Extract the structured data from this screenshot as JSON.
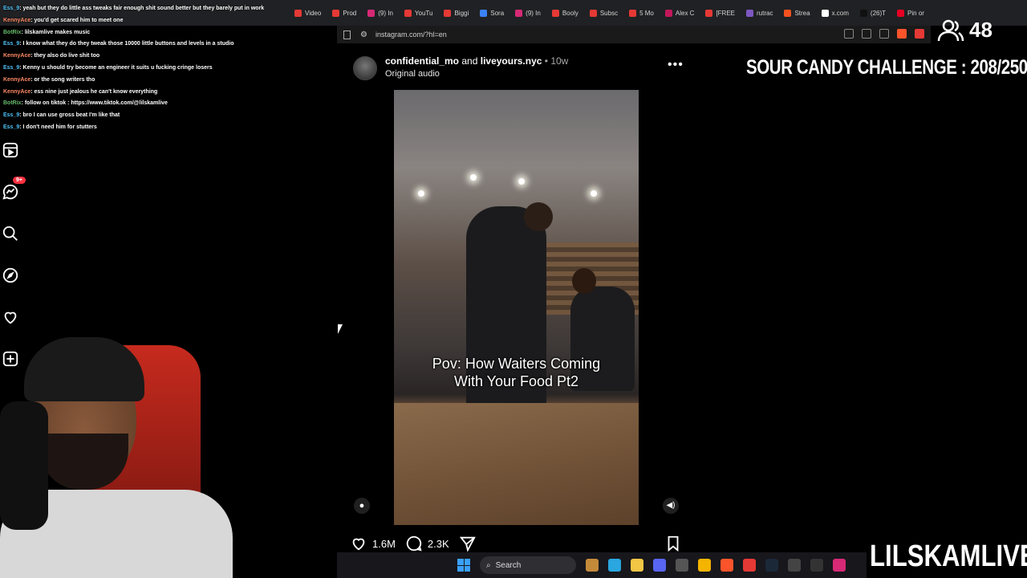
{
  "browser": {
    "tabs": [
      {
        "label": "Video",
        "color": "#e53935"
      },
      {
        "label": "Prod",
        "color": "#e53935"
      },
      {
        "label": "(9) In",
        "color": "#d62976"
      },
      {
        "label": "YouTu",
        "color": "#e53935"
      },
      {
        "label": "Biggi",
        "color": "#e53935"
      },
      {
        "label": "Sora",
        "color": "#3b82f6"
      },
      {
        "label": "(9) In",
        "color": "#d62976"
      },
      {
        "label": "Booly",
        "color": "#e53935"
      },
      {
        "label": "Subsc",
        "color": "#e53935"
      },
      {
        "label": "5 Mo",
        "color": "#e53935"
      },
      {
        "label": "Alex C",
        "color": "#c2185b"
      },
      {
        "label": "[FREE",
        "color": "#e53935"
      },
      {
        "label": "rutrac",
        "color": "#7e57c2"
      },
      {
        "label": "Strea",
        "color": "#f4511e"
      },
      {
        "label": "x.com",
        "color": "#ffffff"
      },
      {
        "label": "(26)T",
        "color": "#111111"
      },
      {
        "label": "Pin or",
        "color": "#e60023"
      }
    ],
    "url": "instagram.com/?hl=en"
  },
  "chat": [
    {
      "user": "Ess_9",
      "text": ": yeah but they do little ass tweaks fair enough shit sound better but they barely put in work",
      "color": "#4fc3f7"
    },
    {
      "user": "KennyAce",
      "text": ": you'd get scared him to meet one",
      "color": "#ff8a65"
    },
    {
      "user": "BotRix",
      "text": ": lilskamlive makes music",
      "color": "#66bb6a"
    },
    {
      "user": "Ess_9",
      "text": ": I know what they do they tweak those 10000 little buttons and levels in a studio",
      "color": "#4fc3f7"
    },
    {
      "user": "KennyAce",
      "text": ": they also do live shit too",
      "color": "#ff8a65"
    },
    {
      "user": "Ess_9",
      "text": ": Kenny u should try become an engineer it suits u fucking cringe losers",
      "color": "#4fc3f7"
    },
    {
      "user": "KennyAce",
      "text": ": or the song writers tho",
      "color": "#ff8a65"
    },
    {
      "user": "KennyAce",
      "text": ": ess nine just jealous he can't know everything",
      "color": "#ff8a65"
    },
    {
      "user": "BotRix",
      "text": ": follow on tiktok : https://www.tiktok.com/@lilskamlive",
      "color": "#66bb6a"
    },
    {
      "user": "Ess_9",
      "text": ": bro I can use gross beat I'm like that",
      "color": "#4fc3f7"
    },
    {
      "user": "Ess_9",
      "text": ": I don't need him for stutters",
      "color": "#4fc3f7"
    }
  ],
  "nav": {
    "badge": "9+"
  },
  "post": {
    "author1": "confidential_mo",
    "and": "and",
    "author2": "liveyours.nyc",
    "time": "• 10w",
    "audio": "Original audio",
    "more": "•••",
    "caption_line1": "Pov: How Waiters Coming",
    "caption_line2": "With Your Food Pt2",
    "likes": "1.6M",
    "comments": "2.3K"
  },
  "overlay": {
    "challenge": "SOUR CANDY CHALLENGE : 208/250",
    "viewers": "48",
    "brand": "LILSKAMLIVE"
  },
  "taskbar": {
    "search_label": "Search"
  }
}
